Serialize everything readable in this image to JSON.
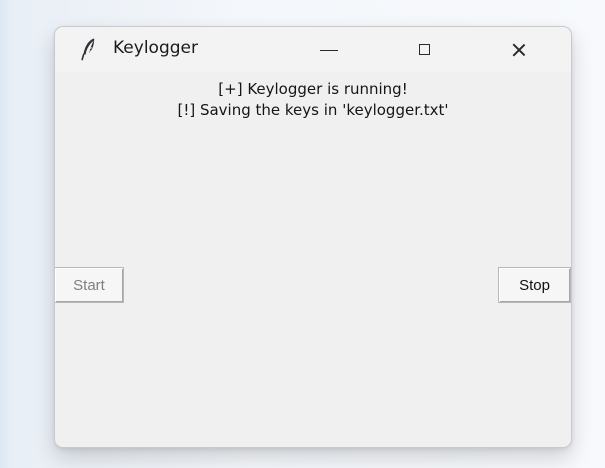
{
  "window": {
    "title": "Keylogger",
    "app_icon": "feather-icon",
    "controls": {
      "minimize": "minimize-icon",
      "maximize": "maximize-icon",
      "close": "close-icon"
    }
  },
  "status": {
    "line1": "[+] Keylogger is running!",
    "line2": "[!] Saving the keys in 'keylogger.txt'"
  },
  "buttons": {
    "start_label": "Start",
    "stop_label": "Stop",
    "start_disabled": true
  },
  "colors": {
    "window_background": "#f0f0f0",
    "text": "#161616",
    "disabled_text": "#808080",
    "button_border": "#b8b8b8"
  }
}
